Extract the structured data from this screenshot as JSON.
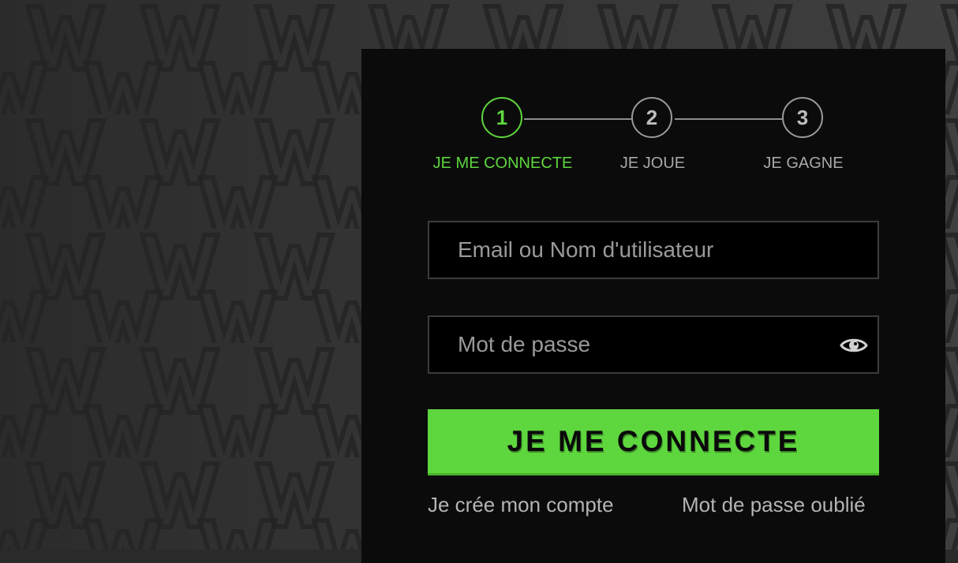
{
  "stepper": {
    "steps": [
      {
        "number": "1",
        "label": "JE ME CONNECTE",
        "active": true
      },
      {
        "number": "2",
        "label": "JE JOUE",
        "active": false
      },
      {
        "number": "3",
        "label": "JE GAGNE",
        "active": false
      }
    ]
  },
  "form": {
    "username_placeholder": "Email ou Nom d'utilisateur",
    "password_placeholder": "Mot de passe",
    "password_toggle_icon": "eye-icon",
    "submit_label": "JE ME CONNECTE"
  },
  "links": {
    "create_account": "Je crée mon compte",
    "forgot_password": "Mot de passe oublié"
  },
  "colors": {
    "accent": "#5ed63e",
    "panel": "#0b0b0b",
    "field_bg": "#000000"
  }
}
